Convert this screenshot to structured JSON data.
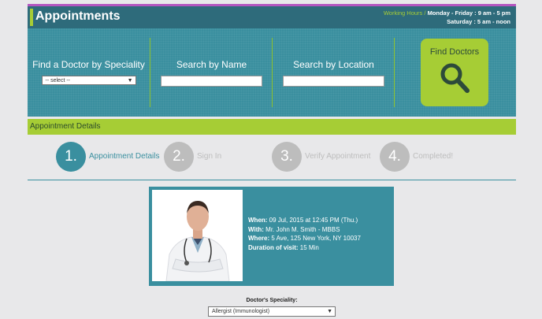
{
  "header": {
    "title": "Appointments",
    "hours_label": "Working Hours /",
    "hours_weekday": "Monday - Friday : 9 am - 5 pm",
    "hours_saturday": "Saturday : 5 am - noon"
  },
  "search": {
    "speciality_label": "Find a Doctor by Speciality",
    "speciality_select": "-- select --",
    "name_label": "Search by Name",
    "location_label": "Search by Location",
    "find_button": "Find Doctors"
  },
  "section_title": "Appointment Details",
  "steps": [
    {
      "num": "1.",
      "label": "Appointment Details"
    },
    {
      "num": "2.",
      "label": "Sign In"
    },
    {
      "num": "3.",
      "label": "Verify Appointment"
    },
    {
      "num": "4.",
      "label": "Completed!"
    }
  ],
  "appointment": {
    "when_label": "When:",
    "when": "09 Jul, 2015 at 12:45 PM (Thu.)",
    "with_label": "With:",
    "with": "Mr. John M. Smith - MBBS",
    "where_label": "Where:",
    "where": "5 Ave, 125 New York, NY 10037",
    "duration_label": "Duration of visit:",
    "duration": "15 Min"
  },
  "speciality_field": {
    "label": "Doctor's Speciality:",
    "value": "Allergist (Immunologist)"
  },
  "colors": {
    "teal": "#3a8f9f",
    "dark_teal": "#2e6b7b",
    "lime": "#a6cd35",
    "gray": "#bdbdbd"
  }
}
